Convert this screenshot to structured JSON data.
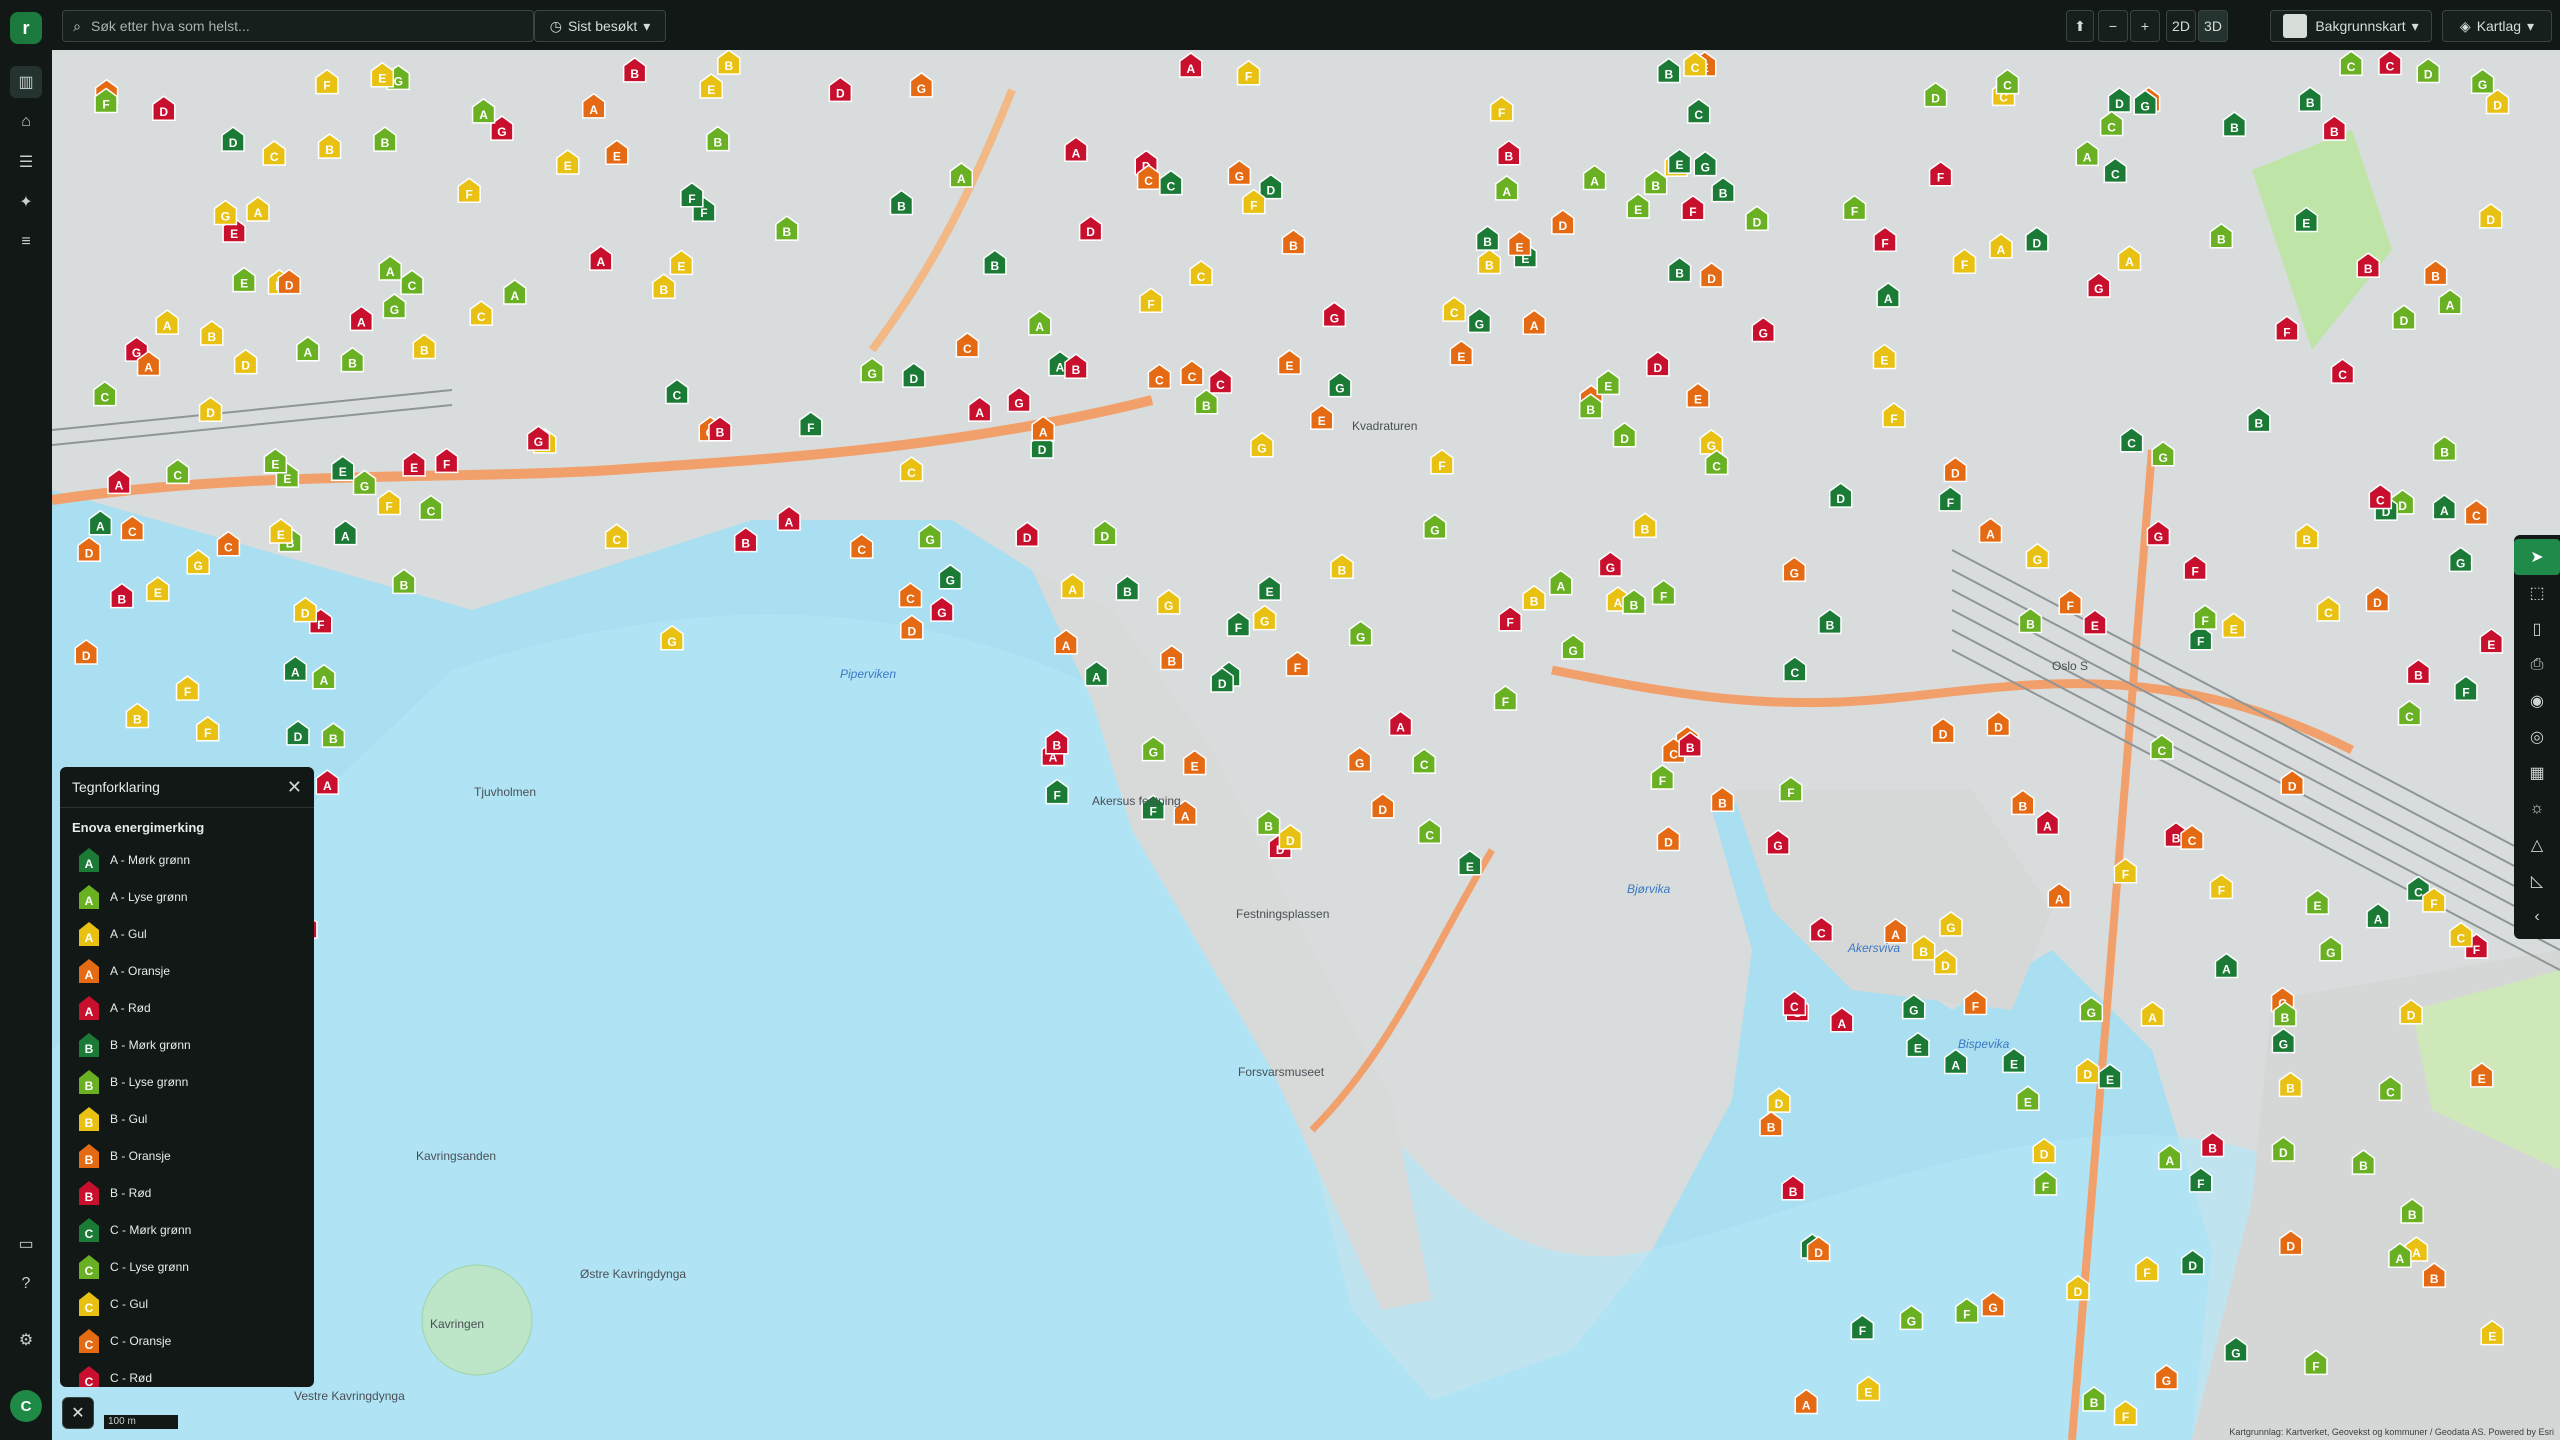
{
  "app": {
    "logo_text": "r"
  },
  "search": {
    "placeholder": "Søk etter hva som helst..."
  },
  "recent": {
    "label": "Sist besøkt"
  },
  "toolbar": {
    "mode_2d": "2D",
    "mode_3d": "3D",
    "background_label": "Bakgrunnskart",
    "layers_label": "Kartlag",
    "zoom_out": "−",
    "zoom_in": "+"
  },
  "user": {
    "initial": "C"
  },
  "legend": {
    "title": "Tegnforklaring",
    "group_title": "Enova energimerking",
    "items": [
      {
        "letter": "A",
        "label": "A - Mørk grønn",
        "color": "#1b7a36"
      },
      {
        "letter": "A",
        "label": "A - Lyse grønn",
        "color": "#6ab023"
      },
      {
        "letter": "A",
        "label": "A - Gul",
        "color": "#e8c113"
      },
      {
        "letter": "A",
        "label": "A - Oransje",
        "color": "#e56a14"
      },
      {
        "letter": "A",
        "label": "A - Rød",
        "color": "#c8102e"
      },
      {
        "letter": "B",
        "label": "B - Mørk grønn",
        "color": "#1b7a36"
      },
      {
        "letter": "B",
        "label": "B - Lyse grønn",
        "color": "#6ab023"
      },
      {
        "letter": "B",
        "label": "B - Gul",
        "color": "#e8c113"
      },
      {
        "letter": "B",
        "label": "B - Oransje",
        "color": "#e56a14"
      },
      {
        "letter": "B",
        "label": "B - Rød",
        "color": "#c8102e"
      },
      {
        "letter": "C",
        "label": "C - Mørk grønn",
        "color": "#1b7a36"
      },
      {
        "letter": "C",
        "label": "C - Lyse grønn",
        "color": "#6ab023"
      },
      {
        "letter": "C",
        "label": "C - Gul",
        "color": "#e8c113"
      },
      {
        "letter": "C",
        "label": "C - Oransje",
        "color": "#e56a14"
      },
      {
        "letter": "C",
        "label": "C - Rød",
        "color": "#c8102e"
      }
    ]
  },
  "map": {
    "labels": [
      "Piperviken",
      "Bjørvika",
      "Akersus festning",
      "Festningsplassen",
      "Forsvarsmuseet",
      "Kavringsanden",
      "Østre Kavringdynga",
      "Kavringen",
      "Vestre Kavringdynga",
      "Tjuvholmen",
      "Bispevika",
      "Akersviva",
      "Oslo S",
      "Kvadraturen"
    ],
    "scale": "100 m",
    "attribution": "Kartgrunnlag: Kartverket, Geovekst og kommuner / Geodata AS. Powered by Esri"
  }
}
